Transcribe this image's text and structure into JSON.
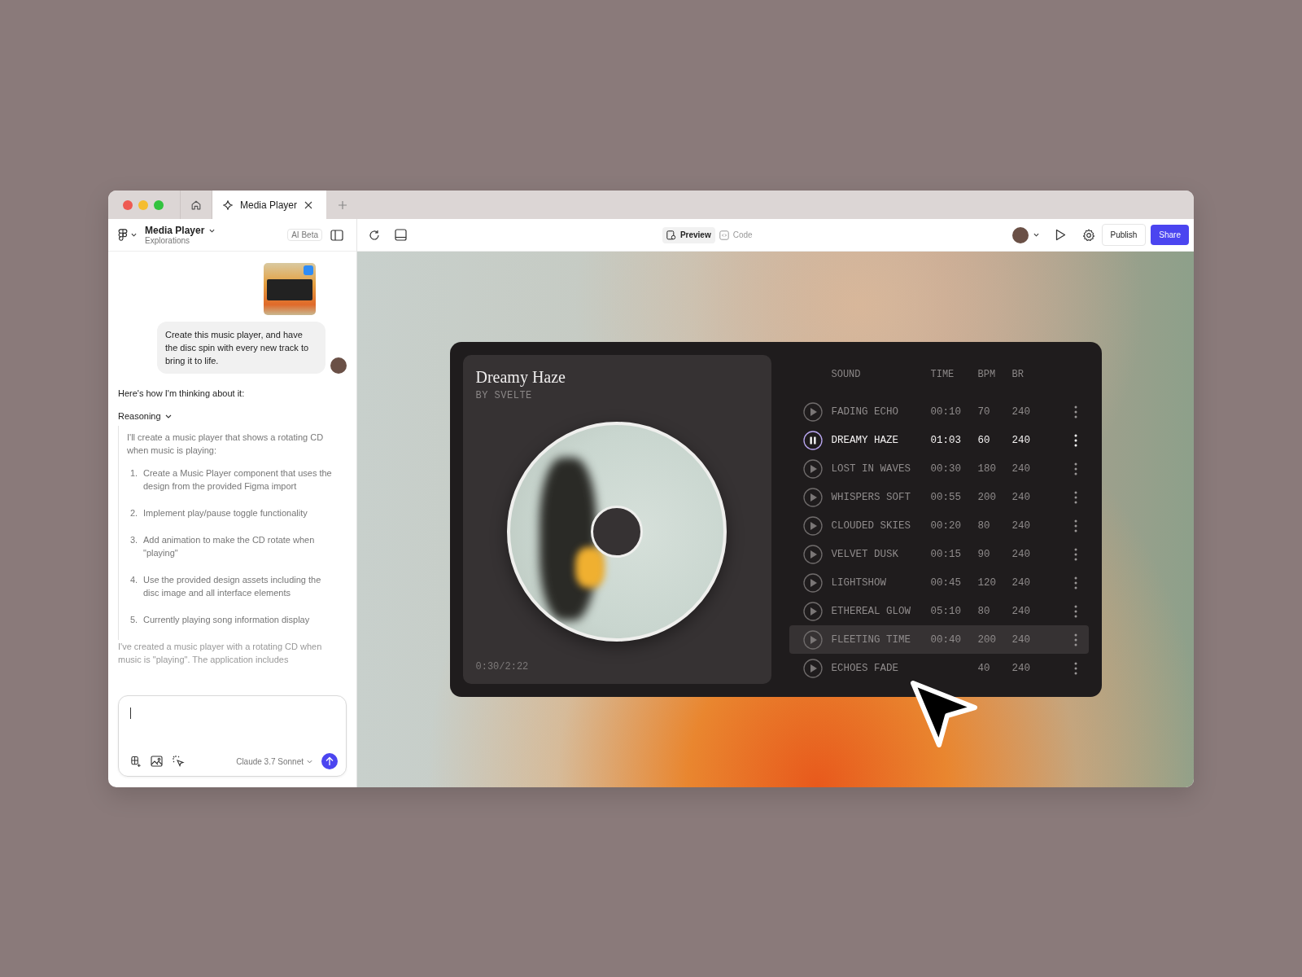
{
  "tabs": [
    {
      "kind": "home",
      "selected": false
    },
    {
      "kind": "file",
      "label": "Media Player",
      "selected": true
    }
  ],
  "sidebar_header": {
    "title": "Media Player",
    "subtitle": "Explorations",
    "badge": "AI Beta"
  },
  "toolbar": {
    "modes": [
      {
        "kind": "preview",
        "label": "Preview",
        "selected": true
      },
      {
        "kind": "code",
        "label": "Code",
        "selected": false
      }
    ],
    "publish": "Publish",
    "share": "Share"
  },
  "chat": {
    "user_message": "Create this music player, and have the disc spin with every new track to bring it to life.",
    "intro": "Here's how I'm thinking about it:",
    "reasoning_label": "Reasoning",
    "reasoning_text": "I'll create a music player that shows a rotating CD when music is playing:",
    "steps": [
      {
        "number": "1.",
        "text": "Create a Music Player component that uses the design from the provided Figma import"
      },
      {
        "number": "2.",
        "text": "Implement play/pause toggle functionality"
      },
      {
        "number": "3.",
        "text": "Add animation to make the CD rotate when \"playing\""
      },
      {
        "number": "4.",
        "text": "Use the provided design assets including the disc image and all interface elements"
      },
      {
        "number": "5.",
        "text": "Currently playing song information display"
      }
    ],
    "summary": "I've created a music player with a rotating CD when music is \"playing\". The application includes"
  },
  "composer": {
    "model": "Claude 3.7 Sonnet"
  },
  "player": {
    "title": "Dreamy Haze",
    "artist": "BY SVELTE",
    "progress": "0:30/2:22",
    "columns": [
      "SOUND",
      "TIME",
      "BPM",
      "BR"
    ],
    "tracks": [
      {
        "sound": "FADING ECHO",
        "time": "00:10",
        "bpm": "70",
        "br": "240",
        "playing": false,
        "hovered": false
      },
      {
        "sound": "DREAMY HAZE",
        "time": "01:03",
        "bpm": "60",
        "br": "240",
        "playing": true,
        "hovered": false
      },
      {
        "sound": "LOST IN WAVES",
        "time": "00:30",
        "bpm": "180",
        "br": "240",
        "playing": false,
        "hovered": false
      },
      {
        "sound": "WHISPERS SOFT",
        "time": "00:55",
        "bpm": "200",
        "br": "240",
        "playing": false,
        "hovered": false
      },
      {
        "sound": "CLOUDED SKIES",
        "time": "00:20",
        "bpm": "80",
        "br": "240",
        "playing": false,
        "hovered": false
      },
      {
        "sound": "VELVET DUSK",
        "time": "00:15",
        "bpm": "90",
        "br": "240",
        "playing": false,
        "hovered": false
      },
      {
        "sound": "LIGHTSHOW",
        "time": "00:45",
        "bpm": "120",
        "br": "240",
        "playing": false,
        "hovered": false
      },
      {
        "sound": "ETHEREAL GLOW",
        "time": "05:10",
        "bpm": "80",
        "br": "240",
        "playing": false,
        "hovered": false
      },
      {
        "sound": "FLEETING TIME",
        "time": "00:40",
        "bpm": "200",
        "br": "240",
        "playing": false,
        "hovered": true
      },
      {
        "sound": "ECHOES FADE",
        "bpm": "40",
        "br": "240",
        "playing": false,
        "hovered": false
      }
    ]
  }
}
